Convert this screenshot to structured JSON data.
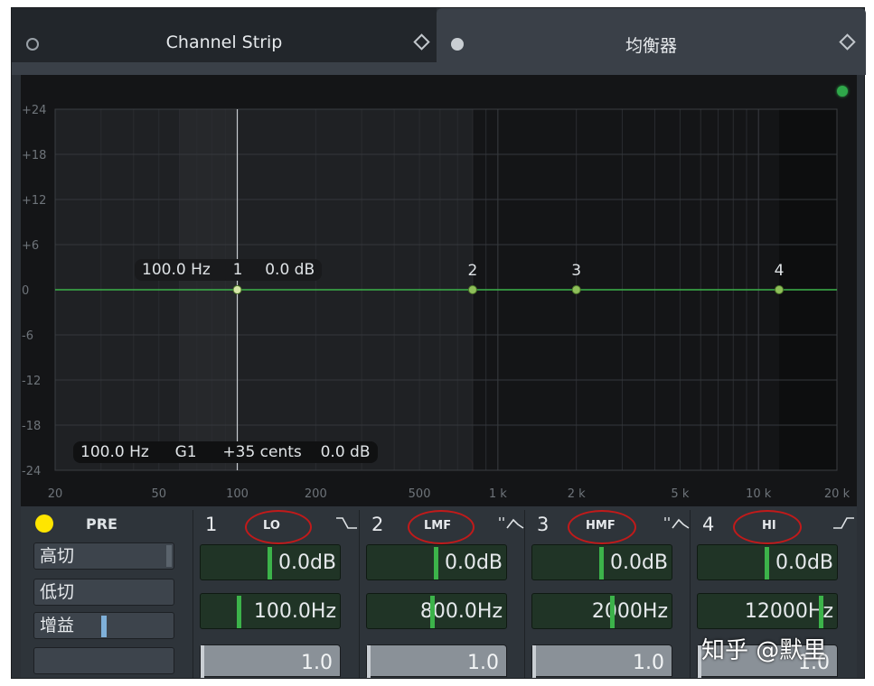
{
  "tabs": [
    {
      "label": "Channel Strip",
      "active": false
    },
    {
      "label": "均衡器",
      "active": true
    }
  ],
  "graph": {
    "y_ticks": [
      "+24",
      "+18",
      "+12",
      "+6",
      "0",
      "-6",
      "-12",
      "-18",
      "-24"
    ],
    "x_ticks": [
      "20",
      "50",
      "100",
      "200",
      "500",
      "1 k",
      "2 k",
      "5 k",
      "10 k",
      "20 k"
    ],
    "point_labels": [
      "1",
      "2",
      "3",
      "4"
    ],
    "tooltip": {
      "freq": "100.0 Hz",
      "num": "1",
      "gain": "0.0 dB"
    },
    "readout": {
      "freq": "100.0 Hz",
      "note": "G1",
      "cents": "+35 cents",
      "gain": "0.0 dB"
    },
    "accent": "#3cb34a"
  },
  "controls": {
    "pre_label": "PRE",
    "high_cut": "高切",
    "low_cut": "低切",
    "gain": "增益"
  },
  "bands": [
    {
      "num": "1",
      "type": "LO",
      "shape_icon": "low-shelf-icon",
      "gain": "0.0dB",
      "freq": "100.0Hz",
      "q": "1.0"
    },
    {
      "num": "2",
      "type": "LMF",
      "shape_icon": "peak-icon",
      "gain": "0.0dB",
      "freq": "800.0Hz",
      "q": "1.0"
    },
    {
      "num": "3",
      "type": "HMF",
      "shape_icon": "peak-icon",
      "gain": "0.0dB",
      "freq": "2000Hz",
      "q": "1.0"
    },
    {
      "num": "4",
      "type": "HI",
      "shape_icon": "high-shelf-icon",
      "gain": "0.0dB",
      "freq": "12000Hz",
      "q": "1.0"
    }
  ],
  "watermark": "知乎 @默里"
}
